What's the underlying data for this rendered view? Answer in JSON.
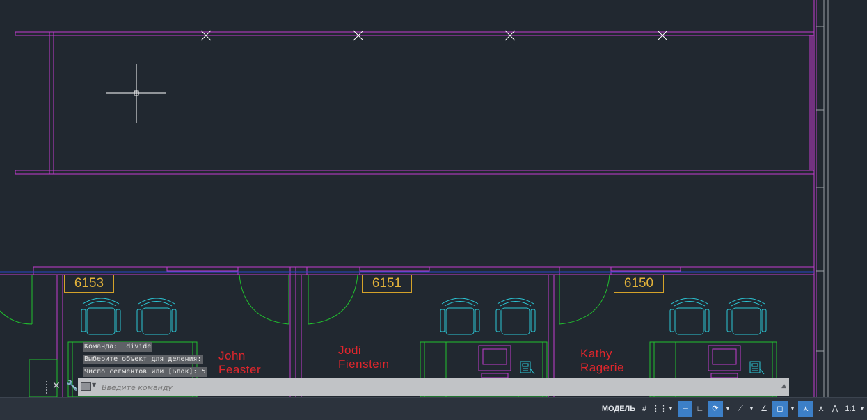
{
  "rooms": [
    {
      "number": "6153"
    },
    {
      "number": "6151"
    },
    {
      "number": "6150"
    }
  ],
  "occupants": [
    {
      "first": "John",
      "last": "Feaster"
    },
    {
      "first": "Jodi",
      "last": "Fienstein"
    },
    {
      "first": "Kathy",
      "last": "Ragerie"
    }
  ],
  "command_history": [
    "Команда: _divide",
    "Выберите объект для деления:",
    "Число сегментов или [Блок]: 5"
  ],
  "command_line": {
    "placeholder": "Введите команду"
  },
  "status_bar": {
    "model_label": "МОДЕЛЬ",
    "scale_label": "1:1",
    "accent_color": "#3c7fc7"
  },
  "colors": {
    "background": "#212830",
    "walls": "#c23ccf",
    "furniture": "#2bc7d6",
    "doors": "#21c22e",
    "room_labels": "#e3b33a",
    "occupant_names": "#e0262c",
    "nodes": "#ffffff"
  }
}
